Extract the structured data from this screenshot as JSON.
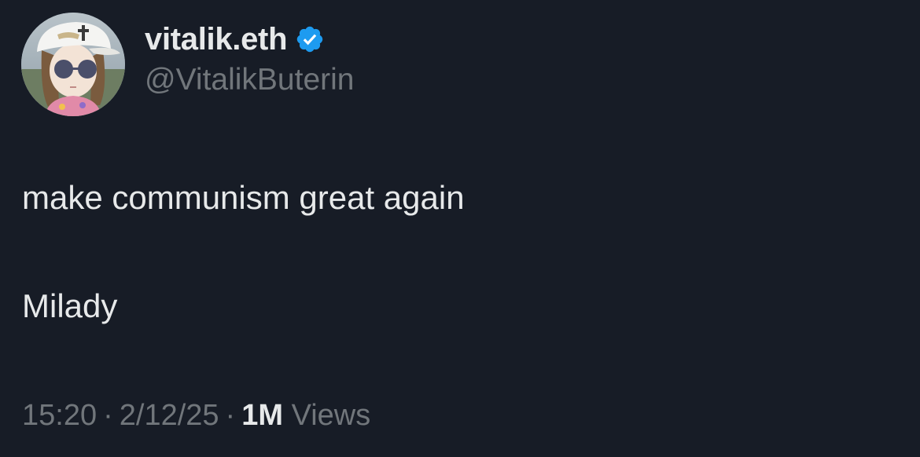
{
  "author": {
    "display_name": "vitalik.eth",
    "handle": "@VitalikButerin",
    "verified": true,
    "verified_color": "#1d9bf0",
    "avatar_icon": "milady-avatar"
  },
  "tweet": {
    "paragraphs": [
      "make communism great again",
      "Milady"
    ]
  },
  "meta": {
    "time": "15:20",
    "date": "2/12/25",
    "separator": "·",
    "views_count": "1M",
    "views_label": "Views"
  },
  "colors": {
    "background": "#171c26",
    "primary_text": "#e7e9ea",
    "secondary_text": "#71767b"
  }
}
